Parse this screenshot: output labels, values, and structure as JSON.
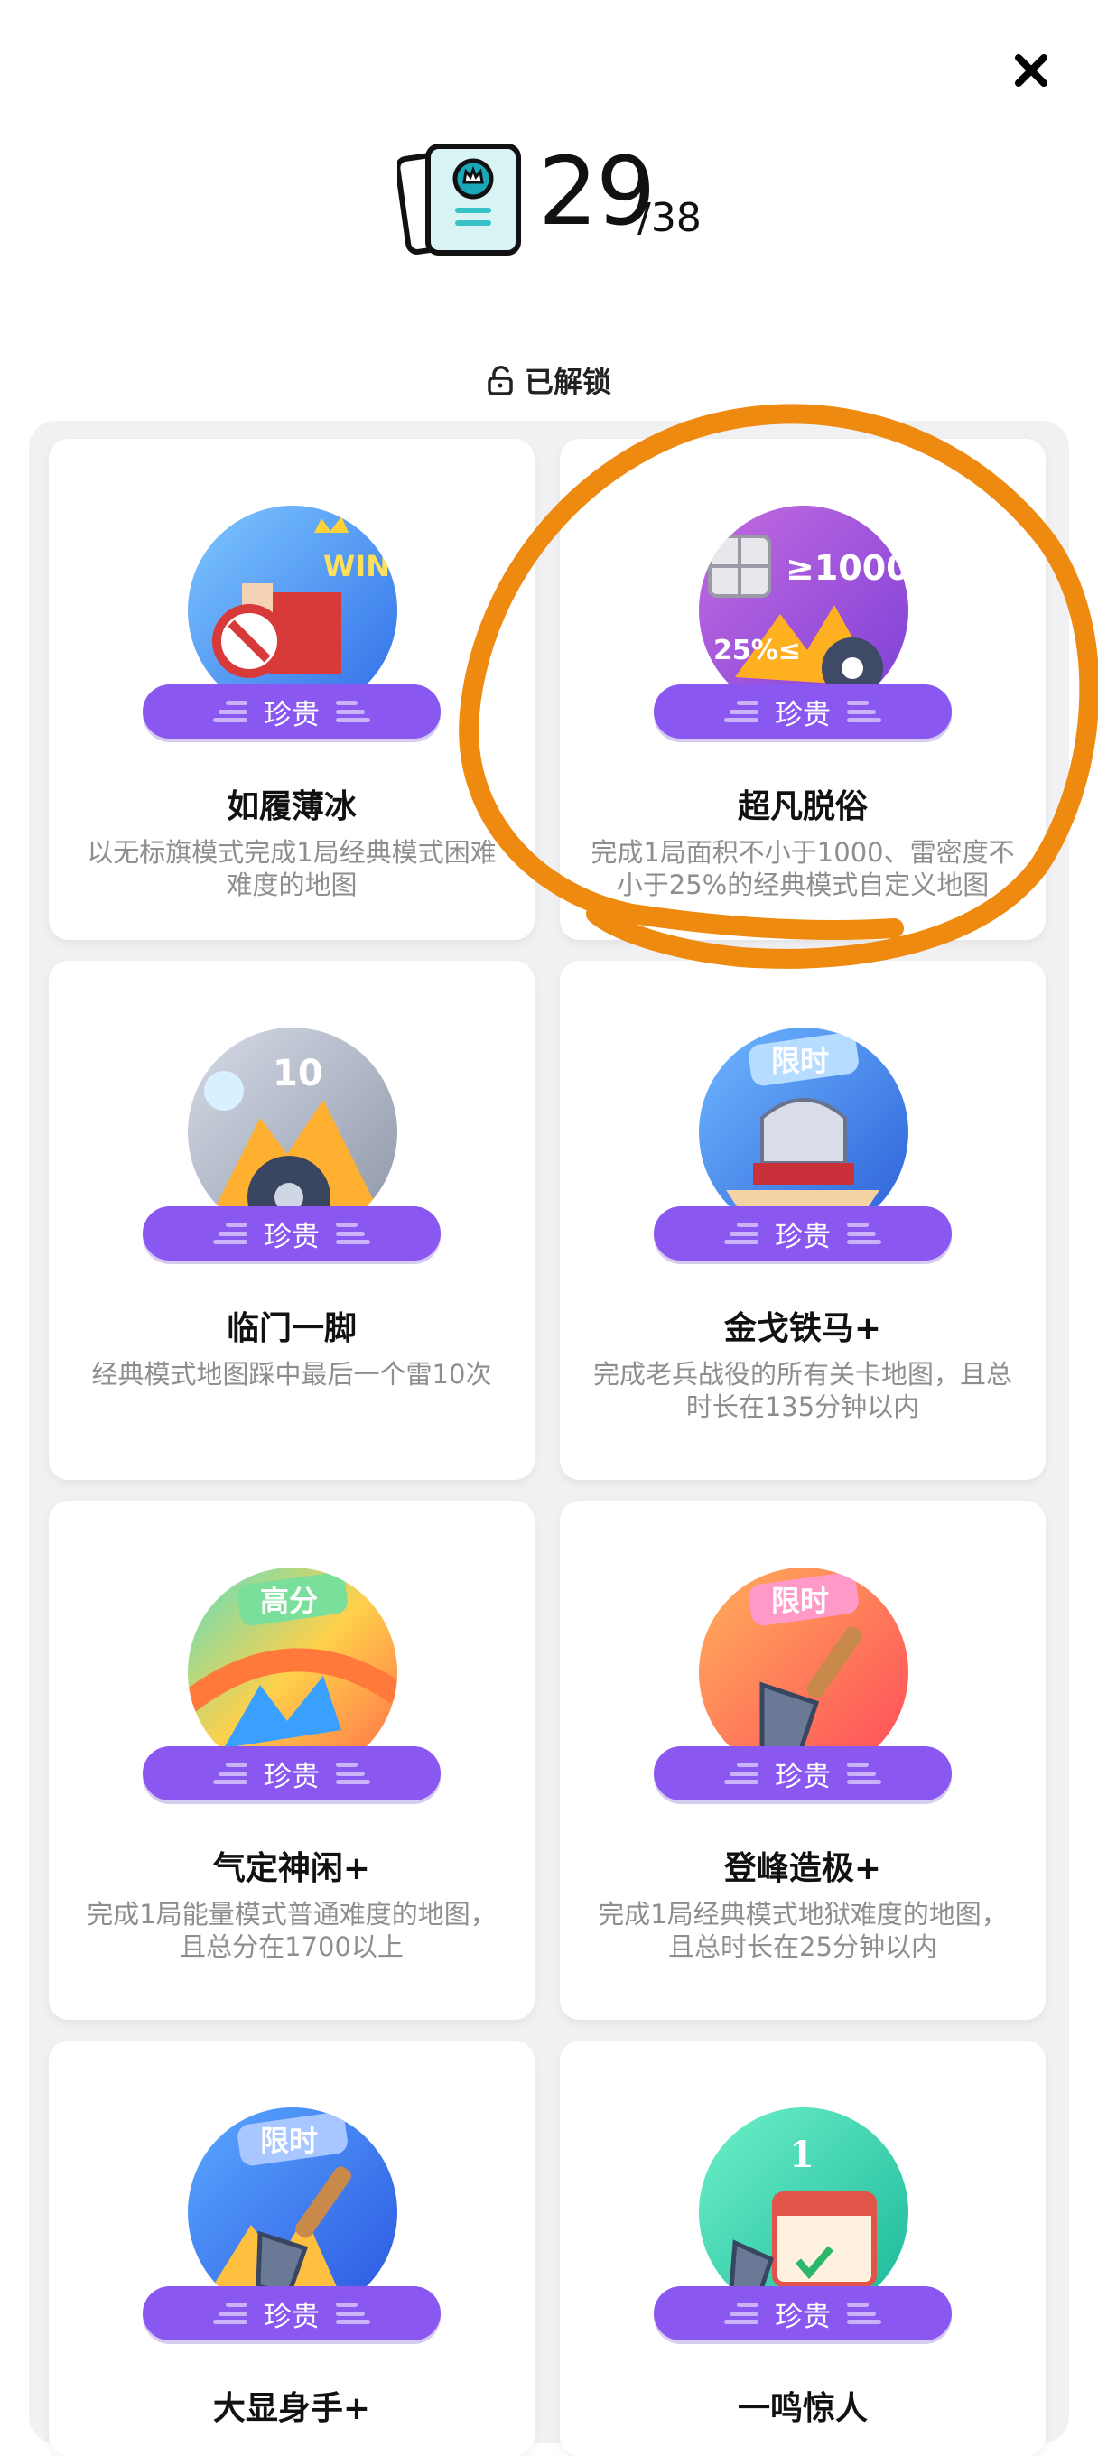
{
  "close_icon": "close-icon",
  "progress": {
    "current": "29",
    "total": "/38"
  },
  "section": {
    "label": "已解锁"
  },
  "rarity_color": "#8a57f0",
  "annotation_color": "#ef8a10",
  "achievements": [
    {
      "rarity": "珍贵",
      "title": "如履薄冰",
      "desc": "以无标旗模式完成1局经典模式困难难度的地图",
      "badge": "win-flag-badge"
    },
    {
      "rarity": "珍贵",
      "title": "超凡脱俗",
      "desc": "完成1局面积不小于1000、雷密度不小于25%的经典模式自定义地图",
      "badge": "mine-density-badge",
      "badge_text_a": "≥1000",
      "badge_text_b": "25%≤"
    },
    {
      "rarity": "珍贵",
      "title": "临门一脚",
      "desc": "经典模式地图踩中最后一个雷10次",
      "badge": "mine-explosion-badge",
      "badge_text_a": "10"
    },
    {
      "rarity": "珍贵",
      "title": "金戈铁马+",
      "desc": "完成老兵战役的所有关卡地图，且总时长在135分钟以内",
      "badge": "knight-helmet-badge",
      "badge_text_a": "限时"
    },
    {
      "rarity": "珍贵",
      "title": "气定神闲+",
      "desc": "完成1局能量模式普通难度的地图，且总分在1700以上",
      "badge": "high-score-badge",
      "badge_text_a": "高分"
    },
    {
      "rarity": "珍贵",
      "title": "登峰造极+",
      "desc": "完成1局经典模式地狱难度的地图，且总时长在25分钟以内",
      "badge": "shovel-badge",
      "badge_text_a": "限时"
    },
    {
      "rarity": "珍贵",
      "title": "大显身手+",
      "desc": "",
      "badge": "shovel-blue-badge",
      "badge_text_a": "限时"
    },
    {
      "rarity": "珍贵",
      "title": "一鸣惊人",
      "desc": "",
      "badge": "calendar-badge",
      "badge_text_a": "1"
    }
  ]
}
